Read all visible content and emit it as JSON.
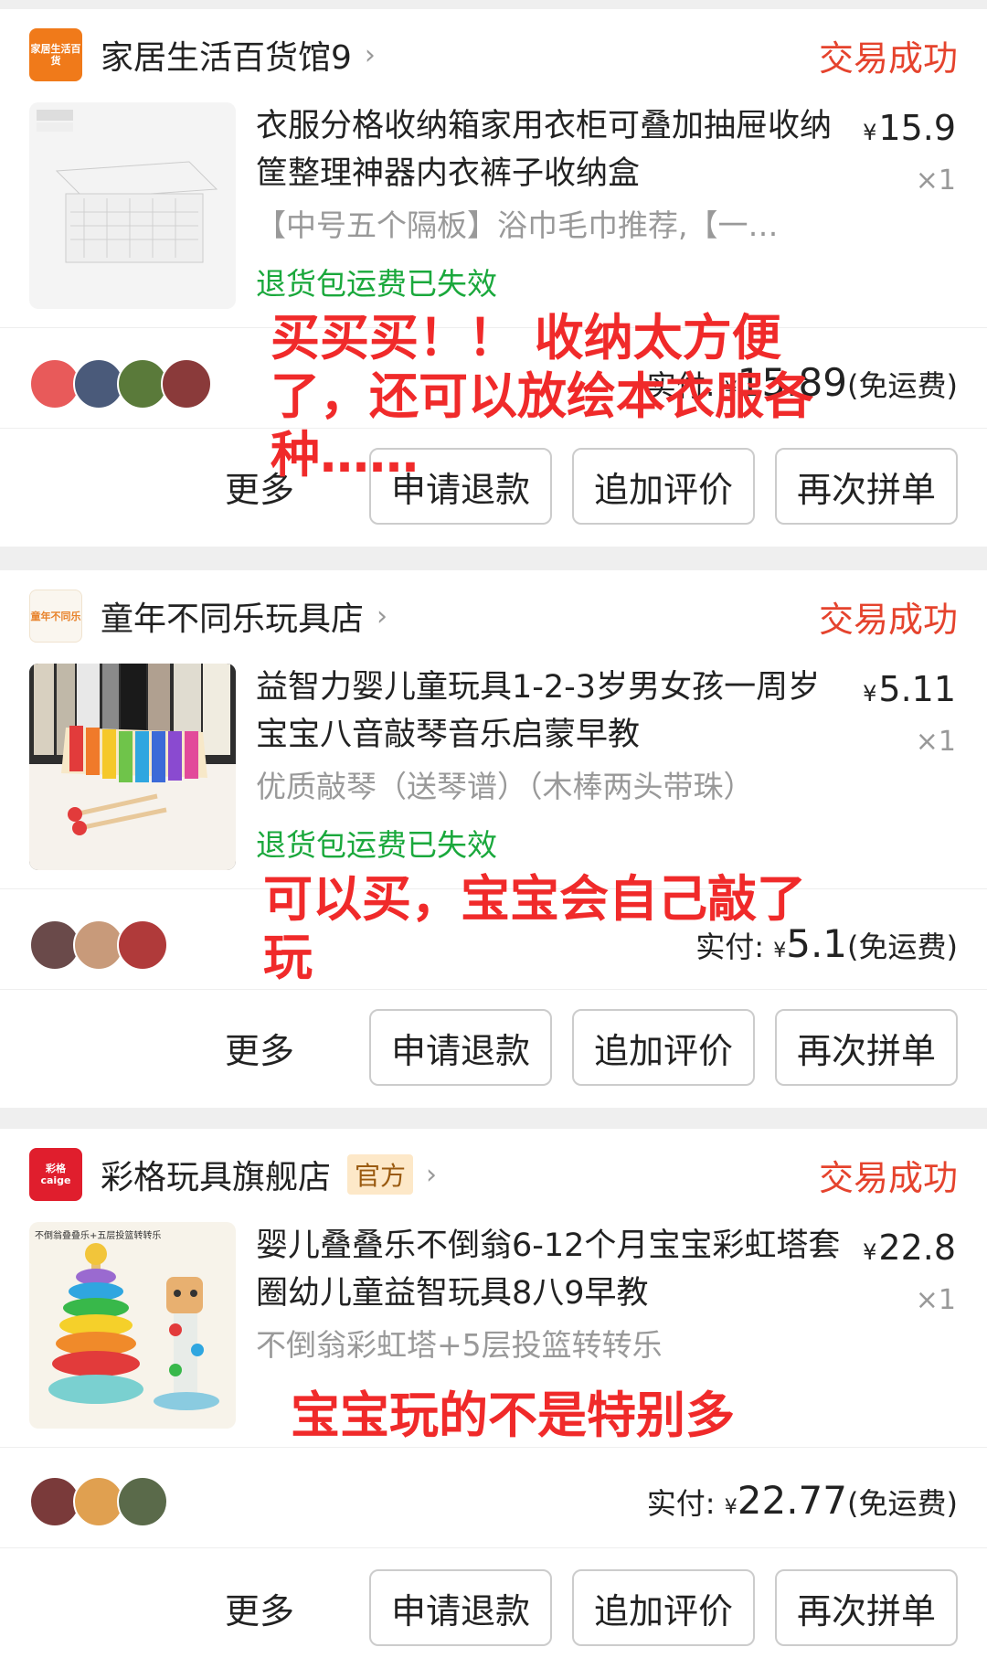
{
  "orders": [
    {
      "shop": "家居生活百货馆9",
      "logo_text": "家居生活百货",
      "status": "交易成功",
      "title": "衣服分格收纳箱家用衣柜可叠加抽屉收纳筐整理神器内衣裤子收纳盒",
      "price_symbol": "¥",
      "price": "15.9",
      "qty": "×1",
      "spec": "【中号五个隔板】浴巾毛巾推荐,【一…",
      "freight": "退货包运费已失效",
      "pay_label": "实付: ",
      "pay_symbol": "¥",
      "pay_amount": "15.89",
      "pay_note": "(免运费)",
      "note": "买买买！！ 收纳太方便了，还可以放绘本衣服各种……",
      "more": "更多",
      "buttons": [
        "申请退款",
        "追加评价",
        "再次拼单"
      ]
    },
    {
      "shop": "童年不同乐玩具店",
      "logo_text": "童年不同乐",
      "status": "交易成功",
      "title": "益智力婴儿童玩具1-2-3岁男女孩一周岁宝宝八音敲琴音乐启蒙早教",
      "price_symbol": "¥",
      "price": "5.11",
      "qty": "×1",
      "spec": "优质敲琴（送琴谱）（木棒两头带珠）",
      "freight": "退货包运费已失效",
      "pay_label": "实付: ",
      "pay_symbol": "¥",
      "pay_amount": "5.1",
      "pay_note": "(免运费)",
      "note": "可以买，宝宝会自己敲了玩",
      "more": "更多",
      "buttons": [
        "申请退款",
        "追加评价",
        "再次拼单"
      ]
    },
    {
      "shop": "彩格玩具旗舰店",
      "logo_text": "彩格 caige",
      "official": "官方",
      "status": "交易成功",
      "title": "婴儿叠叠乐不倒翁6-12个月宝宝彩虹塔套圈幼儿童益智玩具8八9早教",
      "price_symbol": "¥",
      "price": "22.8",
      "qty": "×1",
      "spec": "不倒翁彩虹塔+5层投篮转转乐",
      "thumb_text": "不倒翁叠叠乐+五层投篮转转乐",
      "pay_label": "实付: ",
      "pay_symbol": "¥",
      "pay_amount": "22.77",
      "pay_note": "(免运费)",
      "note": "宝宝玩的不是特别多",
      "more": "更多",
      "buttons": [
        "申请退款",
        "追加评价",
        "再次拼单"
      ]
    }
  ],
  "colors": {
    "status": "#e5432d",
    "freight": "#1aa83c",
    "annotation": "#f02a2a"
  },
  "icons": [
    "chevron-right-icon",
    "avatar"
  ]
}
